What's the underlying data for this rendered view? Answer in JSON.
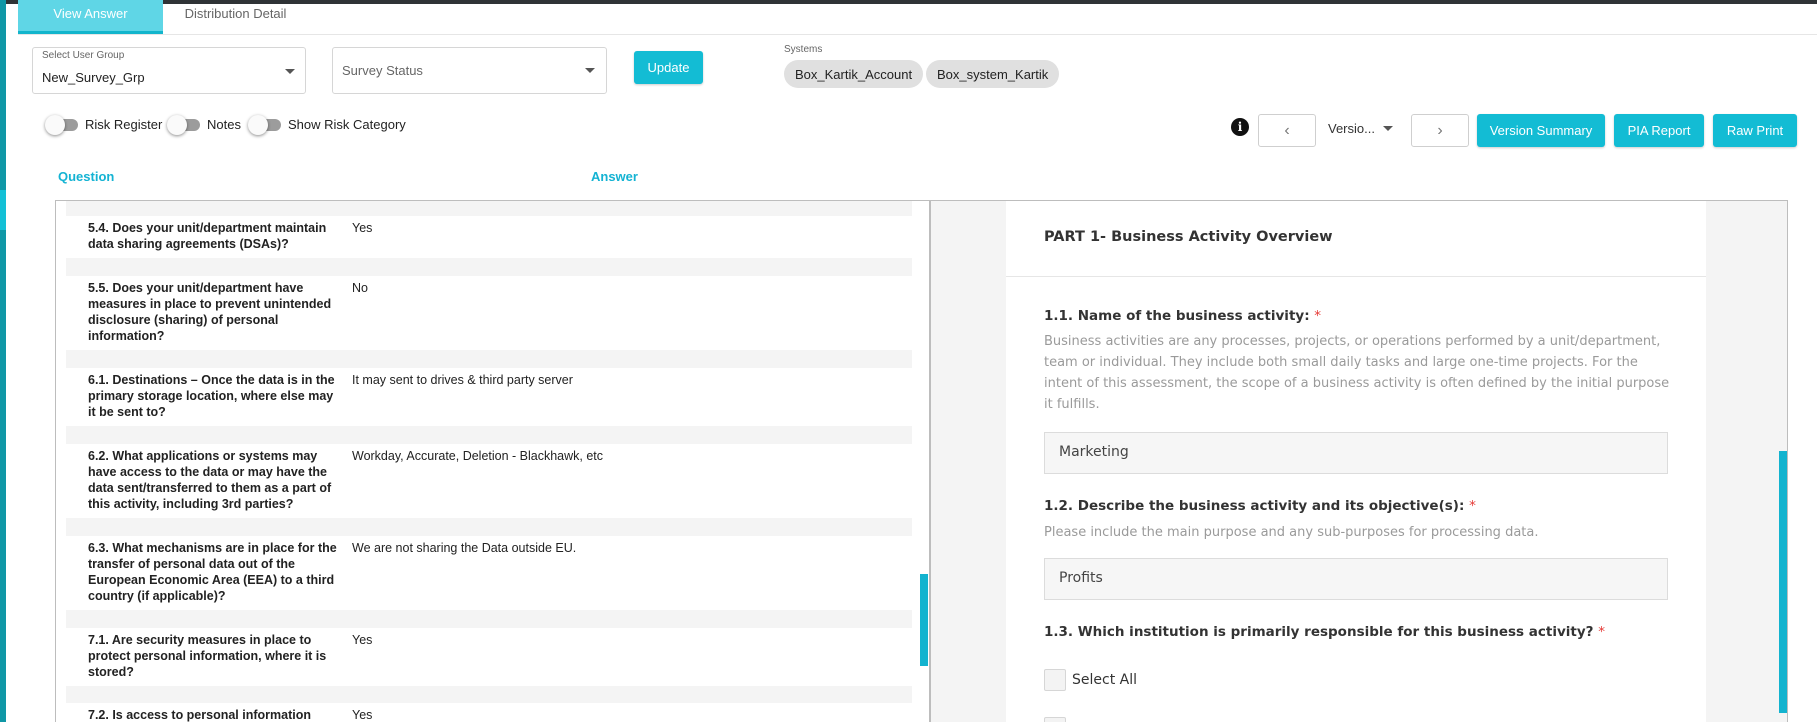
{
  "tabs": [
    {
      "label": "View Answer",
      "active": true
    },
    {
      "label": "Distribution Detail",
      "active": false
    }
  ],
  "filters": {
    "user_group_label": "Select User Group",
    "user_group_value": "New_Survey_Grp",
    "survey_status_placeholder": "Survey Status",
    "update_label": "Update"
  },
  "systems": {
    "label": "Systems",
    "chips": [
      "Box_Kartik_Account",
      "Box_system_Kartik"
    ]
  },
  "toggles": [
    {
      "label": "Risk Register",
      "on": false
    },
    {
      "label": "Notes",
      "on": false
    },
    {
      "label": "Show Risk Category",
      "on": false
    }
  ],
  "toolbar": {
    "info_glyph": "i",
    "prev_glyph": "‹",
    "next_glyph": "›",
    "version_label": "Versio...",
    "version_summary_label": "Version Summary",
    "pia_report_label": "PIA Report",
    "raw_print_label": "Raw Print"
  },
  "columns": {
    "question": "Question",
    "answer": "Answer"
  },
  "qa_rows": [
    {
      "question": "5.4. Does your unit/department maintain data sharing agreements (DSAs)?",
      "answer": "Yes"
    },
    {
      "question": "5.5. Does your unit/department have measures in place to prevent unintended disclosure (sharing) of personal information?",
      "answer": "No"
    },
    {
      "question": "6.1. Destinations – Once the data is in the primary storage location, where else may it be sent to?",
      "answer": "It may sent to drives & third party server"
    },
    {
      "question": "6.2. What applications or systems may have access to the data or may have the data sent/transferred to them as a part of this activity, including 3rd parties?",
      "answer": "Workday, Accurate, Deletion - Blackhawk, etc"
    },
    {
      "question": "6.3. What mechanisms are in place for the transfer of personal data out of the European Economic Area (EEA) to a third country (if applicable)?",
      "answer": "We are not sharing the Data outside EU."
    },
    {
      "question": "7.1. Are security measures in place to protect personal information, where it is stored?",
      "answer": "Yes"
    },
    {
      "question": "7.2. Is access to personal information",
      "answer": "Yes"
    }
  ],
  "form": {
    "part_title": "PART 1- Business Activity Overview",
    "required_mark": "*",
    "q1": {
      "label": "1.1. Name of the business activity:",
      "help": "Business activities are any processes, projects, or operations performed by a unit/department, team or individual. They include both small daily tasks and large one-time projects. For the intent of this assessment, the scope of a business activity is often defined by the initial purpose it fulfills.",
      "value": "Marketing"
    },
    "q2": {
      "label": "1.2. Describe the business activity and its objective(s):",
      "help": "Please include the main purpose and any sub-purposes for processing data.",
      "value": "Profits"
    },
    "q3": {
      "label": "1.3. Which institution is primarily responsible for this business activity?",
      "select_all_label": "Select All"
    }
  }
}
